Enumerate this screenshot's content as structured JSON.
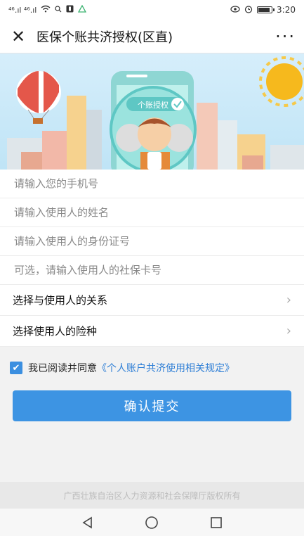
{
  "status_bar": {
    "signal_text": "⁴⁶.ıl ⁴⁶.ıl",
    "time": "3:20"
  },
  "nav": {
    "title": "医保个账共济授权(区直)"
  },
  "banner": {
    "phone_label": "个账授权"
  },
  "form": {
    "phone_placeholder": "请输入您的手机号",
    "name_placeholder": "请输入使用人的姓名",
    "id_placeholder": "请输入使用人的身份证号",
    "card_placeholder": "可选，请输入使用人的社保卡号",
    "relation_label": "选择与使用人的关系",
    "insurance_label": "选择使用人的险种"
  },
  "agreement": {
    "text": "我已阅读并同意",
    "link": "《个人账户共济使用相关规定》",
    "checked": true
  },
  "submit_label": "确认提交",
  "footer_text": "广西壮族自治区人力资源和社会保障厅版权所有",
  "colors": {
    "primary": "#3d94e3",
    "link": "#2f7fd6"
  }
}
